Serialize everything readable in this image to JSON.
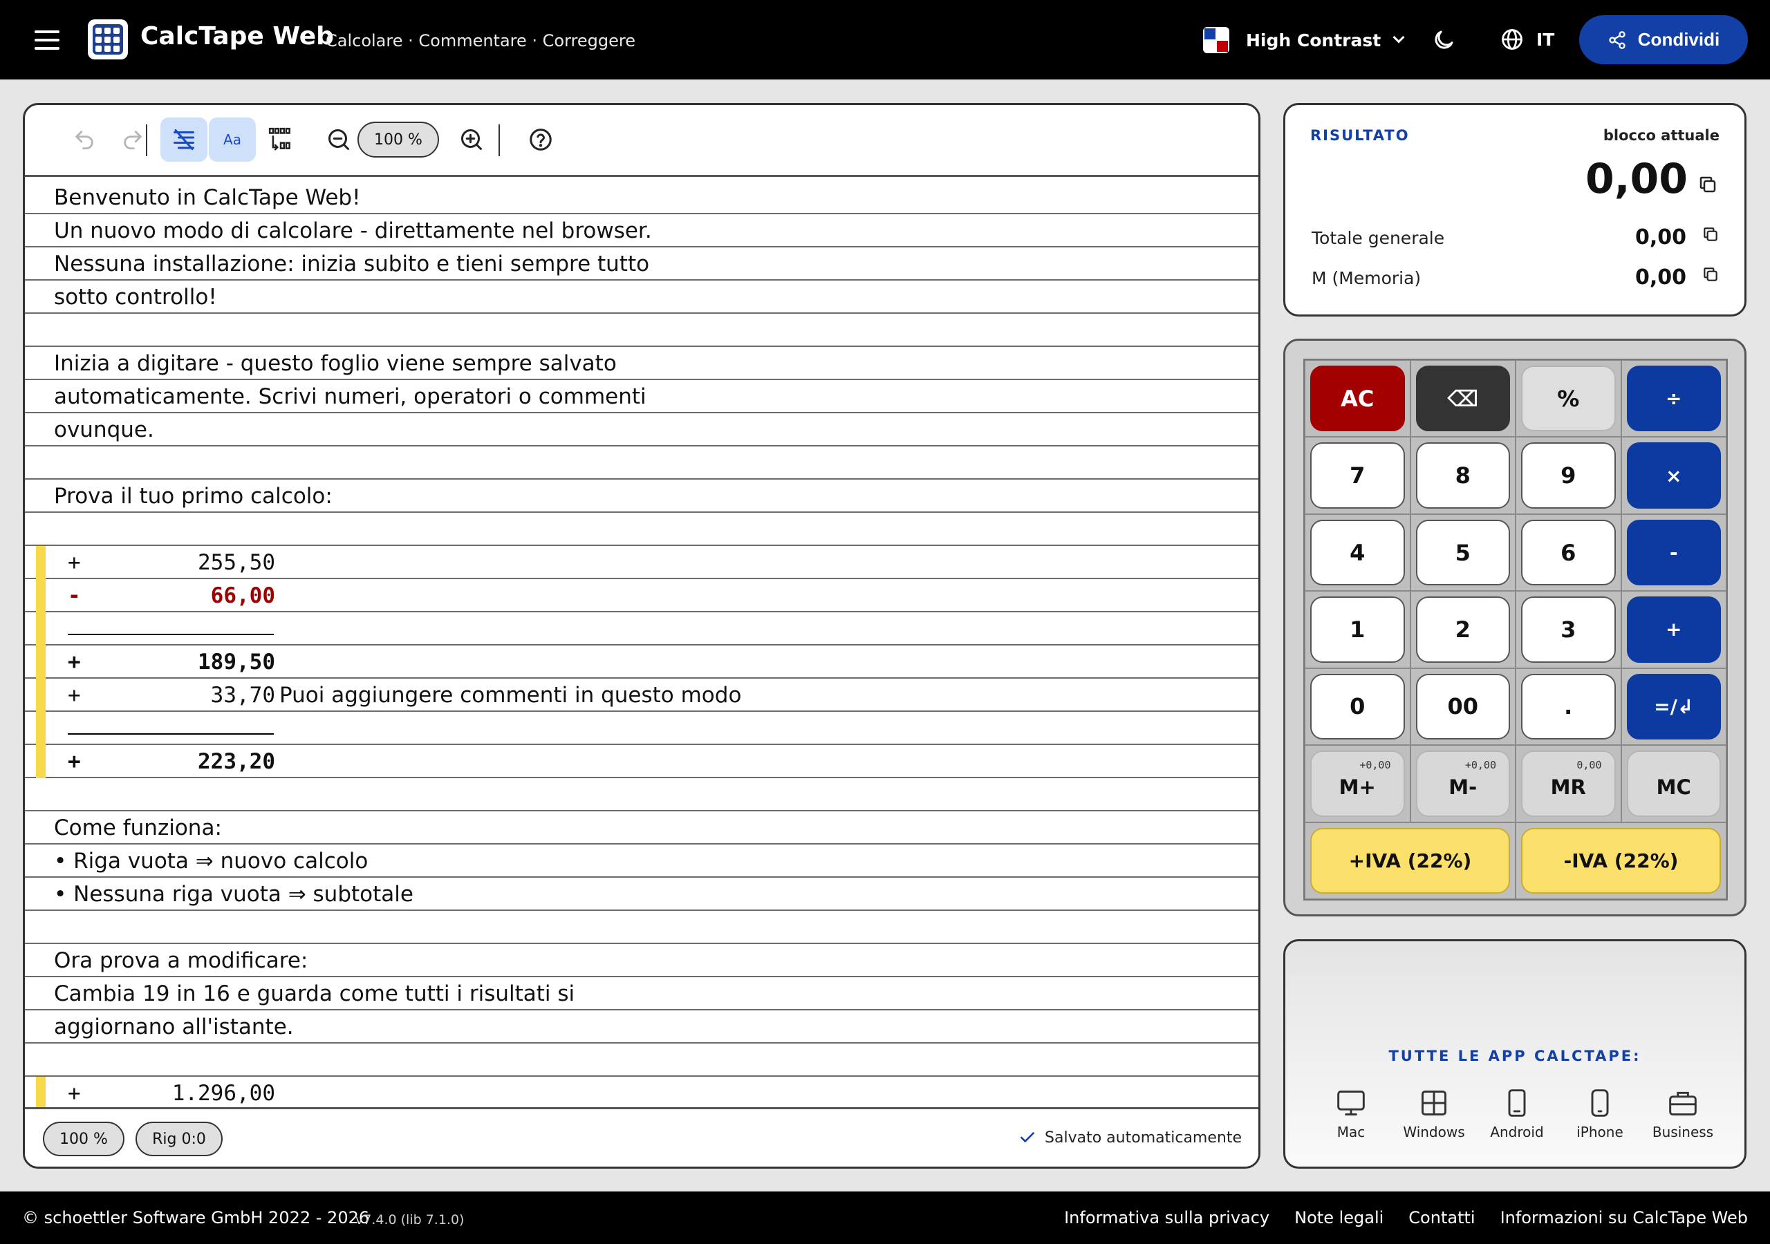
{
  "header": {
    "title": "CalcTape Web",
    "subtitle": "Calcolare · Commentare · Correggere",
    "theme_label": "High Contrast",
    "language": "IT",
    "share_label": "Condividi"
  },
  "editor": {
    "zoom": "100 %",
    "lines": [
      {
        "kind": "text",
        "text": "Benvenuto in CalcTape Web!"
      },
      {
        "kind": "text",
        "text": "Un nuovo modo di calcolare - direttamente nel browser."
      },
      {
        "kind": "text",
        "text": "Nessuna installazione: inizia subito e tieni sempre tutto"
      },
      {
        "kind": "text",
        "text": "sotto controllo!"
      },
      {
        "kind": "empty"
      },
      {
        "kind": "text",
        "text": "Inizia a digitare - questo foglio viene sempre salvato"
      },
      {
        "kind": "text",
        "text": "automaticamente. Scrivi numeri, operatori o commenti"
      },
      {
        "kind": "text",
        "text": "ovunque."
      },
      {
        "kind": "empty"
      },
      {
        "kind": "text",
        "text": "Prova il tuo primo calcolo:"
      },
      {
        "kind": "empty"
      },
      {
        "kind": "calc",
        "op": "+",
        "num": "255,50",
        "style": "normal",
        "mark": true
      },
      {
        "kind": "calc",
        "op": "-",
        "num": "66,00",
        "style": "red",
        "mark": true
      },
      {
        "kind": "rule",
        "mark": true
      },
      {
        "kind": "calc",
        "op": "+",
        "num": "189,50",
        "style": "bold",
        "mark": true
      },
      {
        "kind": "calc",
        "op": "+",
        "num": "33,70",
        "comment": "Puoi aggiungere commenti in questo modo",
        "style": "normal",
        "mark": true
      },
      {
        "kind": "rule",
        "mark": true
      },
      {
        "kind": "calc",
        "op": "+",
        "num": "223,20",
        "style": "bold",
        "mark": true
      },
      {
        "kind": "empty"
      },
      {
        "kind": "text",
        "text": "Come funziona:"
      },
      {
        "kind": "text",
        "text": "• Riga vuota ⇒ nuovo calcolo"
      },
      {
        "kind": "text",
        "text": "• Nessuna riga vuota ⇒ subtotale"
      },
      {
        "kind": "empty"
      },
      {
        "kind": "text",
        "text": "Ora prova a modificare:"
      },
      {
        "kind": "text",
        "text": "Cambia 19 in 16 e guarda come tutti i risultati si"
      },
      {
        "kind": "text",
        "text": "aggiornano all'istante."
      },
      {
        "kind": "empty"
      },
      {
        "kind": "calc",
        "op": "+",
        "num": "1.296,00",
        "style": "normal",
        "mark": true
      }
    ]
  },
  "status": {
    "zoom": "100 %",
    "position": "Rig 0:0",
    "saved": "Salvato automaticamente"
  },
  "result": {
    "heading": "RISULTATO",
    "block_label": "blocco attuale",
    "value": "0,00",
    "total_label": "Totale generale",
    "total_value": "0,00",
    "memory_label": "M (Memoria)",
    "memory_value": "0,00"
  },
  "keypad": {
    "rows": [
      [
        {
          "label": "AC",
          "style": "red"
        },
        {
          "label": "⌫",
          "style": "dark"
        },
        {
          "label": "%",
          "style": "grey"
        },
        {
          "label": "÷",
          "style": "blue"
        }
      ],
      [
        {
          "label": "7",
          "style": "white"
        },
        {
          "label": "8",
          "style": "white"
        },
        {
          "label": "9",
          "style": "white"
        },
        {
          "label": "×",
          "style": "blue"
        }
      ],
      [
        {
          "label": "4",
          "style": "white"
        },
        {
          "label": "5",
          "style": "white"
        },
        {
          "label": "6",
          "style": "white"
        },
        {
          "label": "-",
          "style": "blue"
        }
      ],
      [
        {
          "label": "1",
          "style": "white"
        },
        {
          "label": "2",
          "style": "white"
        },
        {
          "label": "3",
          "style": "white"
        },
        {
          "label": "+",
          "style": "blue"
        }
      ],
      [
        {
          "label": "0",
          "style": "white"
        },
        {
          "label": "00",
          "style": "white"
        },
        {
          "label": ".",
          "style": "white"
        },
        {
          "label": "=/↲",
          "style": "blue"
        }
      ],
      [
        {
          "label": "M+",
          "style": "mem",
          "mini": "+0,00"
        },
        {
          "label": "M-",
          "style": "mem",
          "mini": "+0,00"
        },
        {
          "label": "MR",
          "style": "mem",
          "mini": "0,00"
        },
        {
          "label": "MC",
          "style": "mem"
        }
      ],
      [
        {
          "label": "+IVA (22%)",
          "style": "yellow",
          "span": 2
        },
        {
          "label": "-IVA (22%)",
          "style": "yellow",
          "span": 2
        }
      ]
    ]
  },
  "apps": {
    "title": "TUTTE LE APP CALCTAPE:",
    "items": [
      {
        "name": "Mac",
        "icon": "monitor-icon"
      },
      {
        "name": "Windows",
        "icon": "windows-icon"
      },
      {
        "name": "Android",
        "icon": "android-phone-icon"
      },
      {
        "name": "iPhone",
        "icon": "iphone-icon"
      },
      {
        "name": "Business",
        "icon": "briefcase-icon"
      }
    ]
  },
  "footer": {
    "copyright": "© schoettler Software GmbH 2022 - 2026",
    "version": "v7.4.0 (lib 7.1.0)",
    "links": [
      "Informativa sulla privacy",
      "Note legali",
      "Contatti",
      "Informazioni su CalcTape Web"
    ]
  },
  "colors": {
    "accent": "#1340a6",
    "clear_key": "#a30000",
    "vat_key": "#fbe06b",
    "calc_marker": "#f7d94c",
    "negative": "#a00000"
  }
}
